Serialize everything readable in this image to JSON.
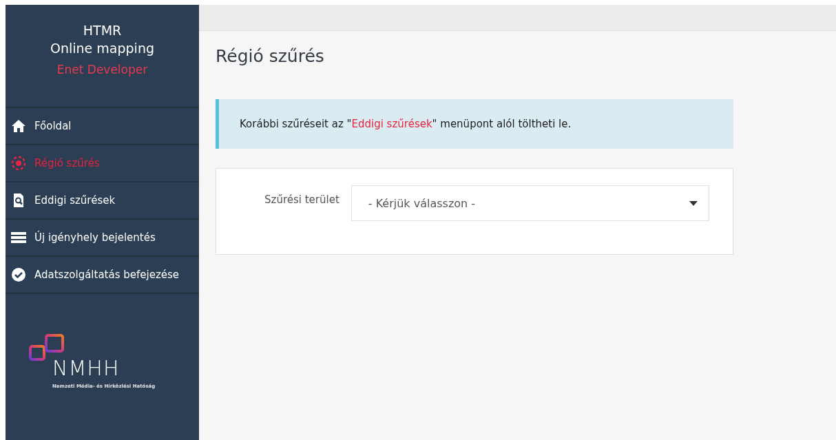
{
  "sidebar": {
    "title": [
      "HTMR",
      "Online mapping"
    ],
    "subtitle": "Enet Developer",
    "items": [
      {
        "label": "Főoldal",
        "selected": false
      },
      {
        "label": "Régió szűrés",
        "selected": true
      },
      {
        "label": "Eddigi szűrések",
        "selected": false
      },
      {
        "label": "Új igényhely bejelentés",
        "selected": false
      },
      {
        "label": "Adatszolgáltatás befejezése",
        "selected": false
      }
    ],
    "logo": {
      "mark": "NMHH",
      "caption": "Nemzeti Média- és Hírközlési Hatóság"
    }
  },
  "page": {
    "title": "Régió szűrés",
    "info": {
      "before": "Korábbi szűréseit az \"",
      "link": "Eddigi szűrések",
      "after": "\" menüpont alól töltheti le."
    },
    "form": {
      "label": "Szűrési terület",
      "select": {
        "value": "- Kérjük válasszon -"
      }
    }
  }
}
